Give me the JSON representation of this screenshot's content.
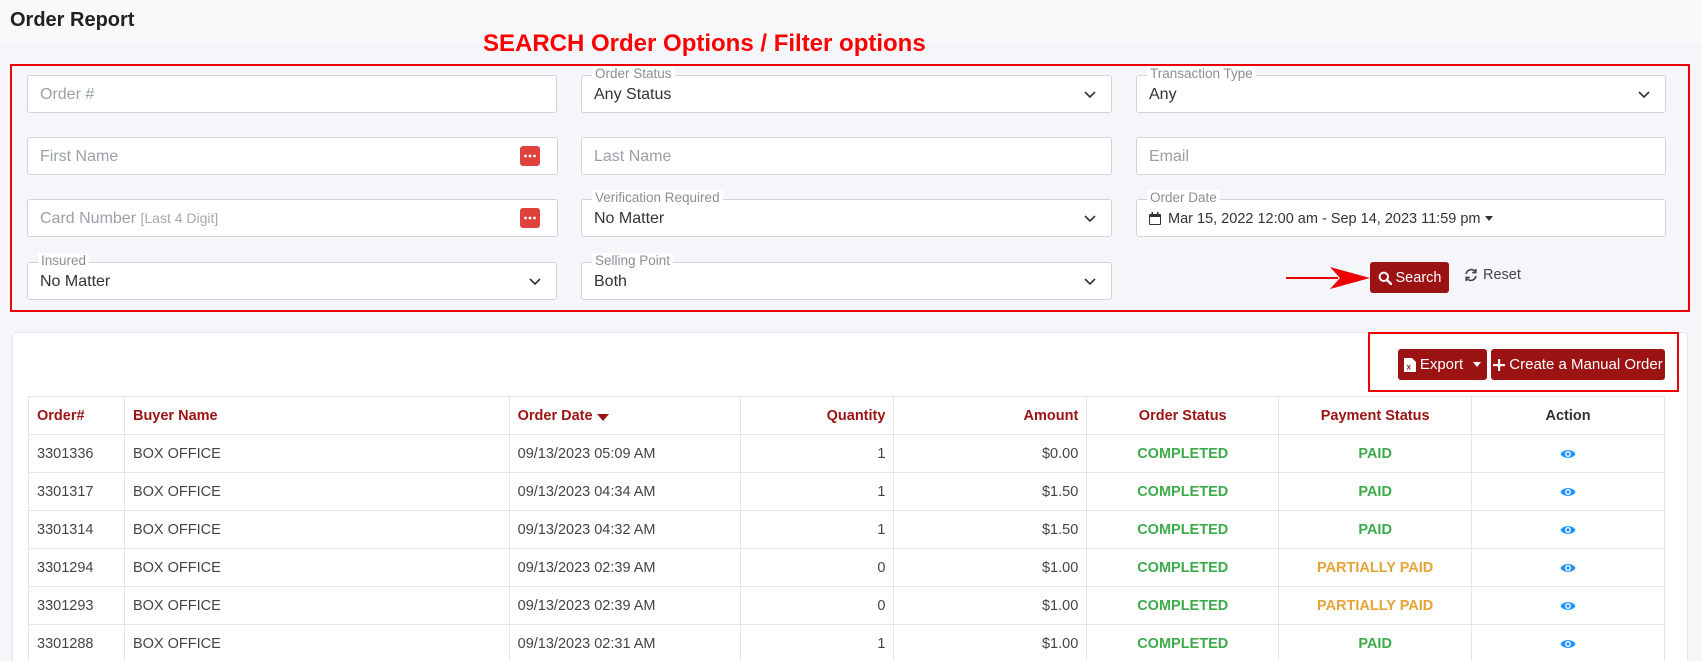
{
  "page": {
    "title": "Order Report"
  },
  "annotation": {
    "label": "SEARCH Order Options / Filter options"
  },
  "filters": {
    "order_number": {
      "placeholder": "Order #"
    },
    "order_status": {
      "label": "Order Status",
      "value": "Any Status"
    },
    "transaction_type": {
      "label": "Transaction Type",
      "value": "Any"
    },
    "first_name": {
      "placeholder": "First Name"
    },
    "last_name": {
      "placeholder": "Last Name"
    },
    "email": {
      "placeholder": "Email"
    },
    "card_number": {
      "placeholder": "Card Number",
      "hint": "[Last 4 Digit]"
    },
    "verification_required": {
      "label": "Verification Required",
      "value": "No Matter"
    },
    "order_date": {
      "label": "Order Date",
      "value": "Mar 15, 2022 12:00 am - Sep 14, 2023 11:59 pm"
    },
    "insured": {
      "label": "Insured",
      "value": "No Matter"
    },
    "selling_point": {
      "label": "Selling Point",
      "value": "Both"
    },
    "search_label": "Search",
    "reset_label": "Reset"
  },
  "toolbar": {
    "export_label": "Export",
    "create_label": "Create a Manual Order"
  },
  "table": {
    "headers": {
      "order": "Order#",
      "buyer": "Buyer Name",
      "date": "Order Date",
      "quantity": "Quantity",
      "amount": "Amount",
      "order_status": "Order Status",
      "payment_status": "Payment Status",
      "action": "Action"
    },
    "rows": [
      {
        "order": "3301336",
        "buyer": "BOX OFFICE",
        "date": "09/13/2023 05:09 AM",
        "quantity": "1",
        "amount": "$0.00",
        "order_status": "COMPLETED",
        "payment_status": "PAID"
      },
      {
        "order": "3301317",
        "buyer": "BOX OFFICE",
        "date": "09/13/2023 04:34 AM",
        "quantity": "1",
        "amount": "$1.50",
        "order_status": "COMPLETED",
        "payment_status": "PAID"
      },
      {
        "order": "3301314",
        "buyer": "BOX OFFICE",
        "date": "09/13/2023 04:32 AM",
        "quantity": "1",
        "amount": "$1.50",
        "order_status": "COMPLETED",
        "payment_status": "PAID"
      },
      {
        "order": "3301294",
        "buyer": "BOX OFFICE",
        "date": "09/13/2023 02:39 AM",
        "quantity": "0",
        "amount": "$1.00",
        "order_status": "COMPLETED",
        "payment_status": "PARTIALLY PAID"
      },
      {
        "order": "3301293",
        "buyer": "BOX OFFICE",
        "date": "09/13/2023 02:39 AM",
        "quantity": "0",
        "amount": "$1.00",
        "order_status": "COMPLETED",
        "payment_status": "PARTIALLY PAID"
      },
      {
        "order": "3301288",
        "buyer": "BOX OFFICE",
        "date": "09/13/2023 02:31 AM",
        "quantity": "1",
        "amount": "$1.00",
        "order_status": "COMPLETED",
        "payment_status": "PAID"
      }
    ]
  },
  "colors": {
    "brand": "#9b1313",
    "annotation": "#ff0000",
    "completed": "#3daa4b",
    "partial": "#e6a33a",
    "eye": "#1e90ff"
  }
}
